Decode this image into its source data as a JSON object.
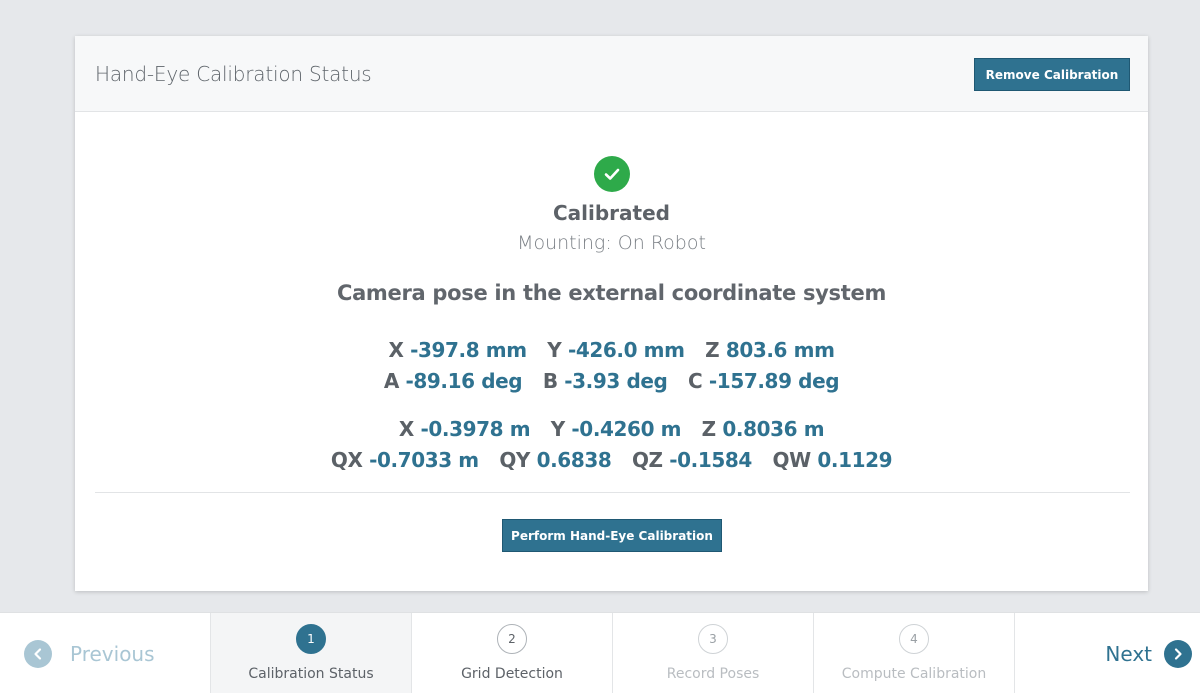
{
  "card": {
    "title": "Hand-Eye Calibration Status",
    "remove_button": "Remove Calibration",
    "status": "Calibrated",
    "mounting": "Mounting: On Robot",
    "pose_title": "Camera pose in the external coordinate system",
    "pose_mm": [
      {
        "key": "X",
        "value": "-397.8 mm"
      },
      {
        "key": "Y",
        "value": "-426.0 mm"
      },
      {
        "key": "Z",
        "value": "803.6 mm"
      }
    ],
    "pose_deg": [
      {
        "key": "A",
        "value": "-89.16 deg"
      },
      {
        "key": "B",
        "value": "-3.93 deg"
      },
      {
        "key": "C",
        "value": "-157.89 deg"
      }
    ],
    "pose_m": [
      {
        "key": "X",
        "value": "-0.3978 m"
      },
      {
        "key": "Y",
        "value": "-0.4260 m"
      },
      {
        "key": "Z",
        "value": "0.8036 m"
      }
    ],
    "pose_quat": [
      {
        "key": "QX",
        "value": "-0.7033 m"
      },
      {
        "key": "QY",
        "value": "0.6838"
      },
      {
        "key": "QZ",
        "value": "-0.1584"
      },
      {
        "key": "QW",
        "value": "0.1129"
      }
    ],
    "perform_button": "Perform Hand-Eye Calibration"
  },
  "wizard": {
    "previous": "Previous",
    "next": "Next",
    "steps": [
      {
        "num": "1",
        "label": "Calibration Status",
        "state": "active"
      },
      {
        "num": "2",
        "label": "Grid Detection",
        "state": "done"
      },
      {
        "num": "3",
        "label": "Record Poses",
        "state": "disabled"
      },
      {
        "num": "4",
        "label": "Compute Calibration",
        "state": "disabled"
      }
    ]
  },
  "icons": {
    "status": "check-icon",
    "previous": "chevron-left-icon",
    "next": "chevron-right-icon"
  },
  "colors": {
    "accent": "#2f7290",
    "success": "#2eaa4a"
  }
}
